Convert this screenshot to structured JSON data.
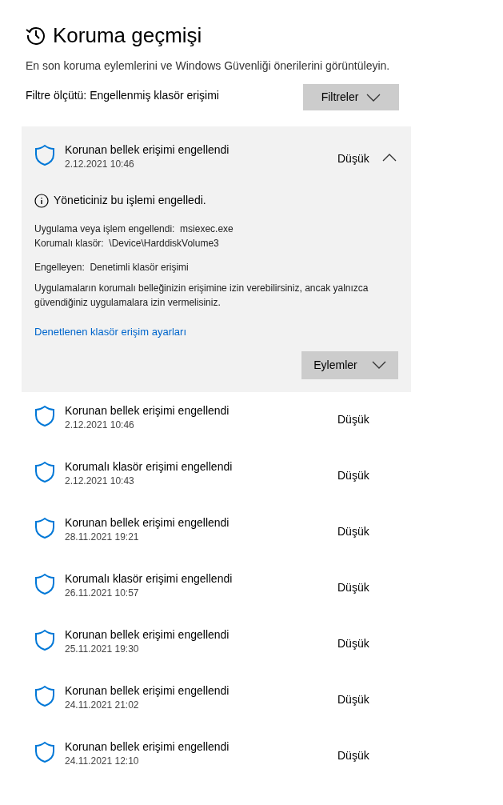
{
  "header": {
    "title": "Koruma geçmişi",
    "description": "En son koruma eylemlerini ve Windows Güvenliği önerilerini görüntüleyin."
  },
  "filter": {
    "label": "Filtre ölçütü: Engellenmiş klasör erişimi",
    "button": "Filtreler"
  },
  "events": [
    {
      "title": "Korunan bellek erişimi engellendi",
      "date": "2.12.2021 10:46",
      "severity": "Düşük",
      "expanded": true,
      "details": {
        "notice": "Yöneticiniz bu işlemi engelledi.",
        "lines": [
          "Uygulama veya işlem engellendi:  msiexec.exe",
          "Korumalı klasör:  \\Device\\HarddiskVolume3"
        ],
        "blocked_by": "Engelleyen:  Denetimli klasör erişimi",
        "info": "Uygulamaların korumalı belleğinizin erişimine izin verebilirsiniz, ancak yalnızca güvendiğiniz uygulamalara izin vermelisiniz.",
        "link": "Denetlenen klasör erişim ayarları",
        "actions": "Eylemler"
      }
    },
    {
      "title": "Korunan bellek erişimi engellendi",
      "date": "2.12.2021 10:46",
      "severity": "Düşük",
      "expanded": false
    },
    {
      "title": "Korumalı klasör erişimi engellendi",
      "date": "2.12.2021 10:43",
      "severity": "Düşük",
      "expanded": false
    },
    {
      "title": "Korunan bellek erişimi engellendi",
      "date": "28.11.2021 19:21",
      "severity": "Düşük",
      "expanded": false
    },
    {
      "title": "Korumalı klasör erişimi engellendi",
      "date": "26.11.2021 10:57",
      "severity": "Düşük",
      "expanded": false
    },
    {
      "title": "Korunan bellek erişimi engellendi",
      "date": "25.11.2021 19:30",
      "severity": "Düşük",
      "expanded": false
    },
    {
      "title": "Korunan bellek erişimi engellendi",
      "date": "24.11.2021 21:02",
      "severity": "Düşük",
      "expanded": false
    },
    {
      "title": "Korunan bellek erişimi engellendi",
      "date": "24.11.2021 12:10",
      "severity": "Düşük",
      "expanded": false
    }
  ]
}
